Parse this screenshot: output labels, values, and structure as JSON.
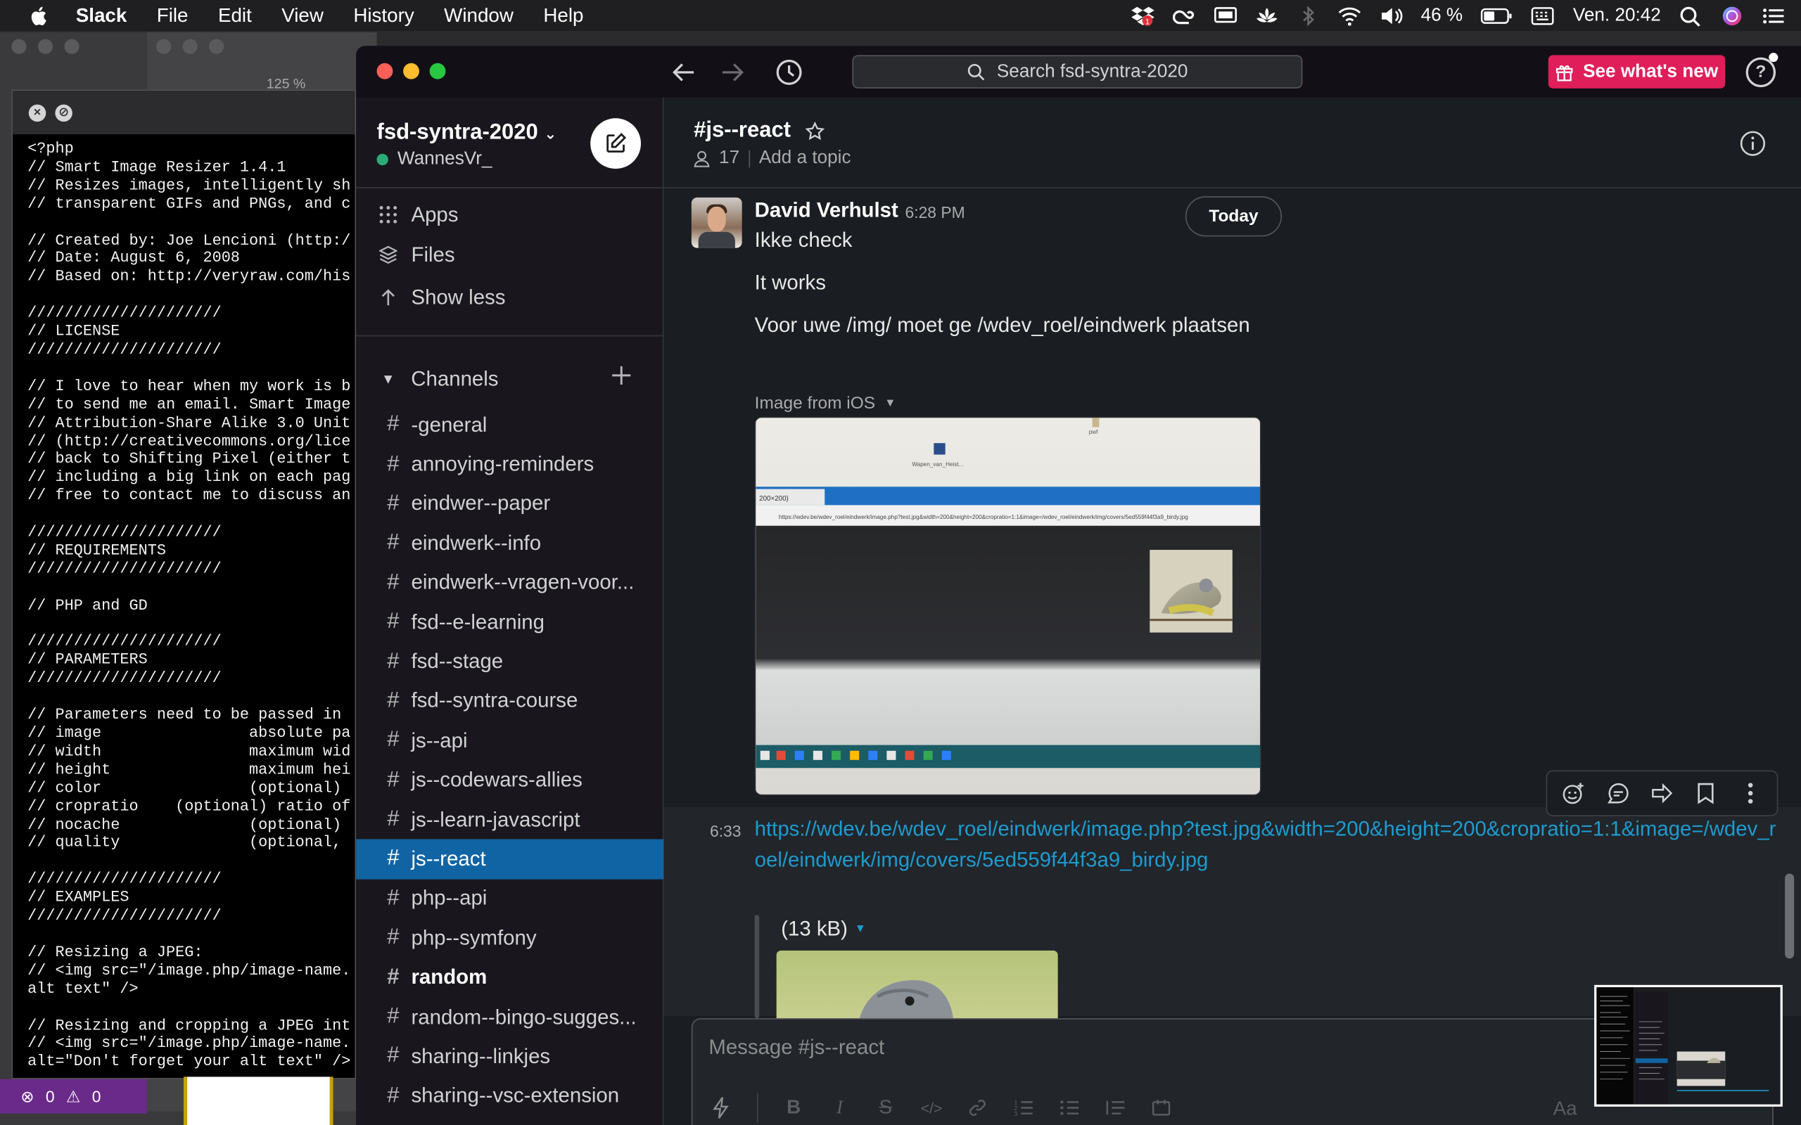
{
  "menubar": {
    "app": "Slack",
    "items": [
      "File",
      "Edit",
      "View",
      "History",
      "Window",
      "Help"
    ],
    "battery": "46 %",
    "clock": "Ven. 20:42",
    "icons": [
      "dropbox-icon",
      "creative-cloud-icon",
      "display-icon",
      "lotus-icon",
      "bluetooth-icon",
      "wifi-icon",
      "volume-icon",
      "battery-icon",
      "keyboard-icon",
      "spotlight-icon",
      "siri-icon",
      "notification-center-icon"
    ]
  },
  "editor": {
    "code": "<?php\n// Smart Image Resizer 1.4.1\n// Resizes images, intelligently sh\n// transparent GIFs and PNGs, and c\n\n// Created by: Joe Lencioni (http:/\n// Date: August 6, 2008\n// Based on: http://veryraw.com/his\n\n/////////////////////\n// LICENSE\n/////////////////////\n\n// I love to hear when my work is b\n// to send me an email. Smart Image\n// Attribution-Share Alike 3.0 Unit\n// (http://creativecommons.org/lice\n// back to Shifting Pixel (either t\n// including a big link on each pag\n// free to contact me to discuss an\n\n/////////////////////\n// REQUIREMENTS\n/////////////////////\n\n// PHP and GD\n\n/////////////////////\n// PARAMETERS\n/////////////////////\n\n// Parameters need to be passed in \n// image                absolute pa\n// width                maximum wid\n// height               maximum hei\n// color                (optional) \n// cropratio    (optional) ratio of\n// nocache              (optional) \n// quality              (optional, \n\n/////////////////////\n// EXAMPLES\n/////////////////////\n\n// Resizing a JPEG:\n// <img src=\"/image.php/image-name.\nalt text\" />\n\n// Resizing and cropping a JPEG int\n// <img src=\"/image.php/image-name.\nalt=\"Don't forget your alt text\" />",
    "status_errors": "0",
    "status_warnings": "0"
  },
  "bg_tabs": {
    "zoom": "125 %"
  },
  "titlebar": {
    "search_placeholder": "Search fsd-syntra-2020",
    "whats_new": "See what's new",
    "help": "?"
  },
  "sidebar": {
    "workspace": "fsd-syntra-2020",
    "user": "WannesVr_",
    "nav": [
      {
        "label": "Apps",
        "icon": "apps-grid-icon"
      },
      {
        "label": "Files",
        "icon": "files-stack-icon"
      },
      {
        "label": "Show less",
        "icon": "arrow-up-icon"
      }
    ],
    "channels_header": "Channels",
    "channels": [
      {
        "name": "-general",
        "active": false,
        "unread": false
      },
      {
        "name": "annoying-reminders",
        "active": false,
        "unread": false
      },
      {
        "name": "eindwer--paper",
        "active": false,
        "unread": false
      },
      {
        "name": "eindwerk--info",
        "active": false,
        "unread": false
      },
      {
        "name": "eindwerk--vragen-voor...",
        "active": false,
        "unread": false
      },
      {
        "name": "fsd--e-learning",
        "active": false,
        "unread": false
      },
      {
        "name": "fsd--stage",
        "active": false,
        "unread": false
      },
      {
        "name": "fsd--syntra-course",
        "active": false,
        "unread": false
      },
      {
        "name": "js--api",
        "active": false,
        "unread": false
      },
      {
        "name": "js--codewars-allies",
        "active": false,
        "unread": false
      },
      {
        "name": "js--learn-javascript",
        "active": false,
        "unread": false
      },
      {
        "name": "js--react",
        "active": true,
        "unread": false
      },
      {
        "name": "php--api",
        "active": false,
        "unread": false
      },
      {
        "name": "php--symfony",
        "active": false,
        "unread": false
      },
      {
        "name": "random",
        "active": false,
        "unread": true
      },
      {
        "name": "random--bingo-sugges...",
        "active": false,
        "unread": false
      },
      {
        "name": "sharing--linkjes",
        "active": false,
        "unread": false
      },
      {
        "name": "sharing--vsc-extension",
        "active": false,
        "unread": false
      }
    ]
  },
  "channel": {
    "title": "#js--react",
    "members": "17",
    "topic": "Add a topic",
    "divider": "Today"
  },
  "messages": {
    "author": "David Verhulst",
    "time": "6:28 PM",
    "lines": [
      "Ikke check",
      "It works",
      "Voor uwe /img/ moet ge /wdev_roel/eindwerk plaatsen"
    ],
    "image_label": "Image from iOS",
    "followup_time": "6:33",
    "link": "https://wdev.be/wdev_roel/eindwerk/image.php?test.jpg&width=200&height=200&cropratio=1:1&image=/wdev_roel/eindwerk/img/covers/5ed559f44f3a9_birdy.jpg",
    "file_size": "(13 kB)"
  },
  "photo_screen": {
    "tab_text": "200×200)",
    "url_text": "https://wdev.be/wdev_roel/eindwerk/image.php?test.jpg&width=200&height=200&cropratio=1:1&image=/wdev_roel/eindwerk/img/covers/5ed559f44f3a9_birdy.jpg",
    "desktop_label": "Wapen_van_Heist...",
    "file_label": "pwf"
  },
  "composer": {
    "placeholder": "Message #js--react",
    "aa": "Aa"
  }
}
